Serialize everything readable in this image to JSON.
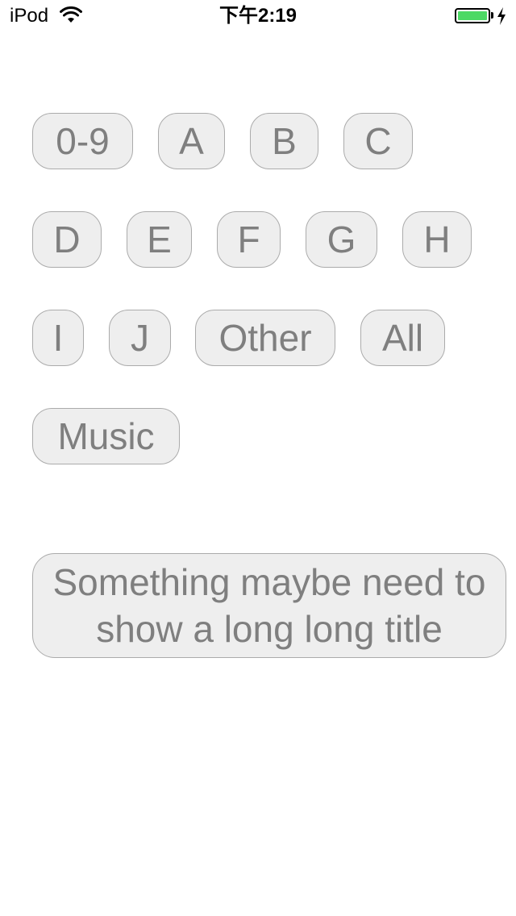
{
  "status_bar": {
    "carrier": "iPod",
    "time": "下午2:19",
    "battery_level": 1.0,
    "battery_color": "#4cd964",
    "wifi_icon": "wifi-icon",
    "charge_icon": "charging-bolt-icon"
  },
  "tags": {
    "t0": "0-9",
    "t1": "A",
    "t2": "B",
    "t3": "C",
    "t4": "D",
    "t5": "E",
    "t6": "F",
    "t7": "G",
    "t8": "H",
    "t9": "I",
    "t10": "J",
    "t11": "Other",
    "t12": "All",
    "t13": "Music"
  },
  "long_title_button": {
    "label": "Something maybe need to show a long long title"
  },
  "colors": {
    "button_background": "#eeeeee",
    "button_border": "#ababab",
    "button_text": "#7f7f7f"
  }
}
